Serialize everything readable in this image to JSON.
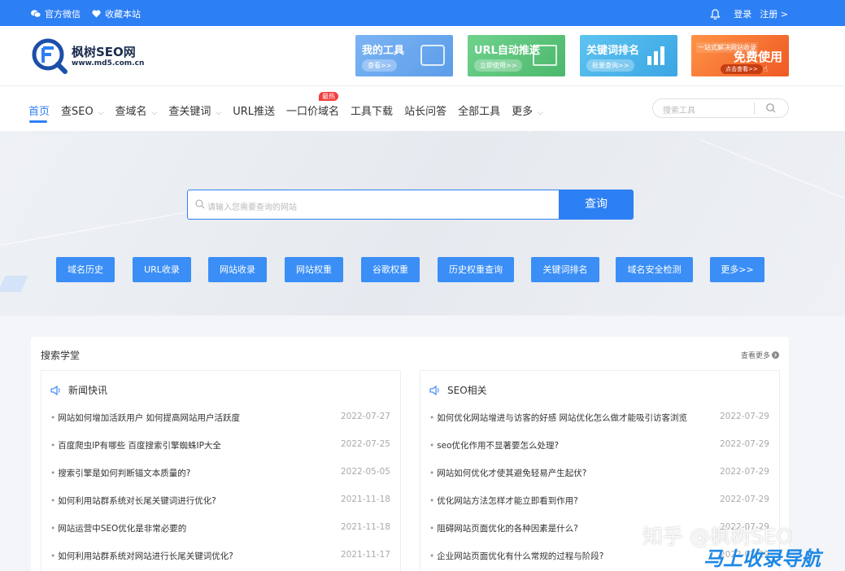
{
  "topbar": {
    "wechat": "官方微信",
    "favorite": "收藏本站",
    "login": "登录",
    "register": "注册 >"
  },
  "logo": {
    "name": "枫树SEO网",
    "url": "www.md5.com.cn"
  },
  "banners": [
    {
      "title": "我的工具",
      "button": "查看>>",
      "color": "#6aa8f0"
    },
    {
      "title": "URL自动推送",
      "button": "立即使用>>",
      "color": "#5cc47c"
    },
    {
      "title": "关键词排名",
      "button": "批量查询>>",
      "color": "#4db5ea"
    },
    {
      "title": "免费使用",
      "sub": "一站式解决网站收录",
      "button": "点击查看>>",
      "color": "#f4793a"
    }
  ],
  "nav": {
    "items": [
      {
        "label": "首页",
        "chevron": false
      },
      {
        "label": "查SEO",
        "chevron": true
      },
      {
        "label": "查域名",
        "chevron": true
      },
      {
        "label": "查关键词",
        "chevron": true
      },
      {
        "label": "URL推送",
        "chevron": false
      },
      {
        "label": "一口价域名",
        "chevron": false
      },
      {
        "label": "工具下载",
        "chevron": false
      },
      {
        "label": "站长问答",
        "chevron": false
      },
      {
        "label": "全部工具",
        "chevron": false
      },
      {
        "label": "更多",
        "chevron": true
      }
    ],
    "hot_badge": "最热",
    "search_placeholder": "搜索工具"
  },
  "hero": {
    "search_placeholder": "请输入您需要查询的网站",
    "search_button": "查询",
    "quick_buttons": [
      "域名历史",
      "URL收录",
      "网站收录",
      "网站权重",
      "谷歌权重",
      "历史权重查询",
      "关键词排名",
      "域名安全检测",
      "更多>>"
    ]
  },
  "panel": {
    "title": "搜索学堂",
    "more": "查看更多",
    "left": {
      "title": "新闻快讯",
      "items": [
        {
          "text": "网站如何增加活跃用户 如何提高网站用户活跃度",
          "date": "2022-07-27"
        },
        {
          "text": "百度爬虫IP有哪些 百度搜索引擎蜘蛛IP大全",
          "date": "2022-07-25"
        },
        {
          "text": "搜索引擎是如何判断锚文本质量的?",
          "date": "2022-05-05"
        },
        {
          "text": "如何利用站群系统对长尾关键词进行优化?",
          "date": "2021-11-18"
        },
        {
          "text": "网站运营中SEO优化是非常必要的",
          "date": "2021-11-18"
        },
        {
          "text": "如何利用站群系统对网站进行长尾关键词优化?",
          "date": "2021-11-17"
        }
      ]
    },
    "right": {
      "title": "SEO相关",
      "items": [
        {
          "text": "如何优化网站增进与访客的好感 网站优化怎么做才能吸引访客浏览",
          "date": "2022-07-29"
        },
        {
          "text": "seo优化作用不显著要怎么处理?",
          "date": "2022-07-29"
        },
        {
          "text": "网站如何优化才使其避免轻易产生起伏?",
          "date": "2022-07-29"
        },
        {
          "text": "优化网站方法怎样才能立即看到作用?",
          "date": "2022-07-29"
        },
        {
          "text": "阻碍网站页面优化的各种因素是什么?",
          "date": "2022-07-29"
        },
        {
          "text": "企业网站页面优化有什么常规的过程与阶段?",
          "date": "2022-07-29"
        }
      ]
    }
  },
  "watermark": {
    "zhihu": "知乎 @枫树SEO",
    "site": "马上收录导航"
  }
}
